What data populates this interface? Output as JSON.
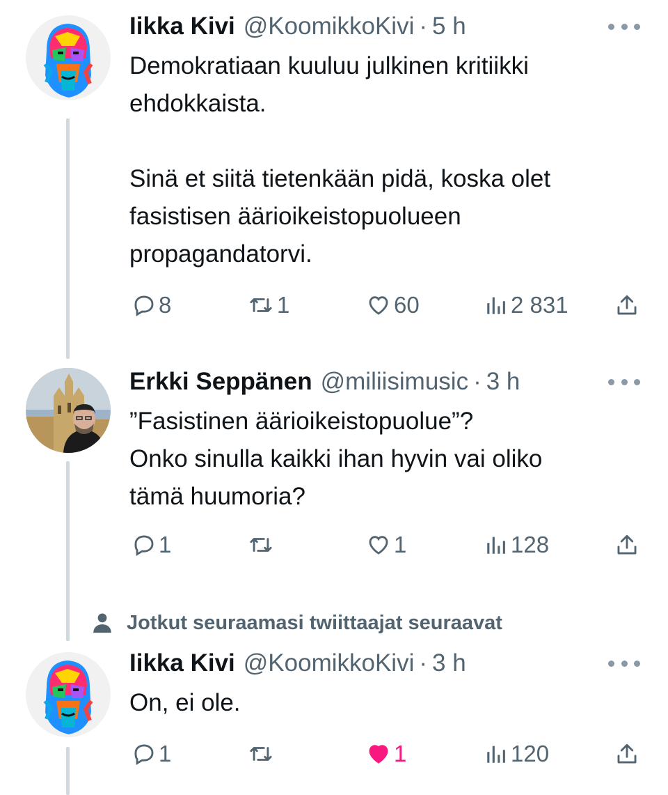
{
  "tweets": [
    {
      "name": "Iikka Kivi",
      "handle": "@KoomikkoKivi",
      "separator": "·",
      "time": "5 h",
      "text": "Demokratiaan kuuluu julkinen kritiikki\nehdokkaista.\n\nSinä et siitä tietenkään pidä, koska olet\nfasistisen äärioikeistopuolueen\npropagandatorvi.",
      "replies": "8",
      "retweets": "1",
      "likes": "60",
      "views": "2 831",
      "liked": false
    },
    {
      "name": "Erkki Seppänen",
      "handle": "@miliisimusic",
      "separator": "·",
      "time": "3 h",
      "text": "”Fasistinen äärioikeistopuolue”?\nOnko sinulla kaikki ihan hyvin vai oliko\ntämä huumoria?",
      "replies": "1",
      "retweets": "",
      "likes": "1",
      "views": "128",
      "liked": false
    },
    {
      "name": "Iikka Kivi",
      "handle": "@KoomikkoKivi",
      "separator": "·",
      "time": "3 h",
      "text": "On, ei ole.",
      "replies": "1",
      "retweets": "",
      "likes": "1",
      "views": "120",
      "liked": true
    }
  ],
  "social_context": "Jotkut seuraamasi twiittaajat seuraavat",
  "colors": {
    "text": "#0f1419",
    "secondary": "#536471",
    "thread_line": "#cfd9de",
    "like_active": "#f91880"
  },
  "icons": [
    "reply-icon",
    "retweet-icon",
    "like-icon",
    "views-icon",
    "share-icon",
    "more-icon",
    "person-icon"
  ]
}
